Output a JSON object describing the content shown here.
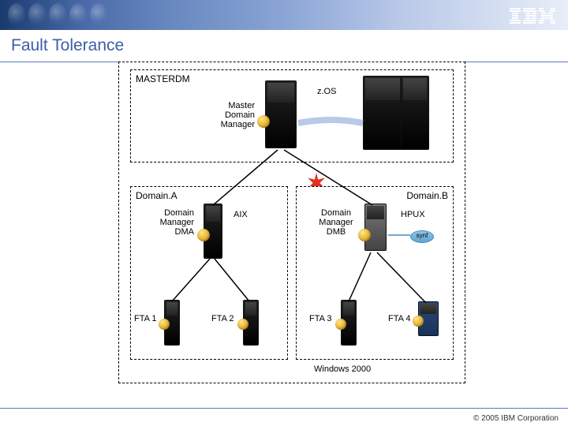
{
  "header": {
    "logo": "IBM",
    "title": "Fault Tolerance"
  },
  "diagram": {
    "master": {
      "box_label": "MASTERDM",
      "manager_label": "Master\nDomain\nManager",
      "os": "z.OS"
    },
    "domainA": {
      "box_label": "Domain.A",
      "manager_label": "Domain\nManager\nDMA",
      "os": "AIX",
      "fta1": "FTA 1",
      "fta2": "FTA 2"
    },
    "domainB": {
      "box_label": "Domain.B",
      "manager_label": "Domain\nManager\nDMB",
      "os": "HPUX",
      "fta3": "FTA 3",
      "fta4": "FTA 4",
      "disk": "synf"
    },
    "windows_label": "Windows 2000"
  },
  "footer": {
    "copyright": "© 2005 IBM Corporation"
  }
}
